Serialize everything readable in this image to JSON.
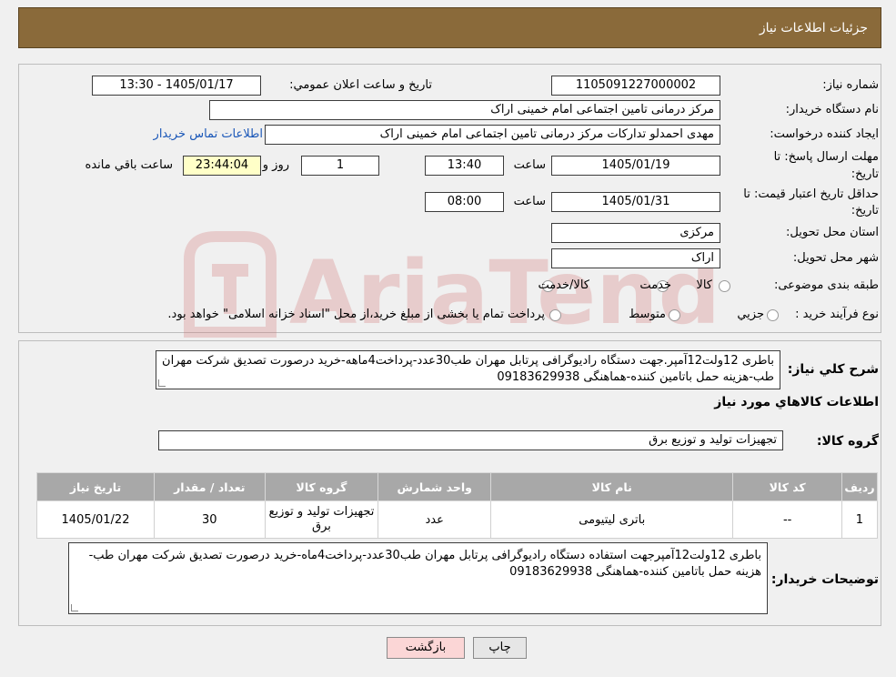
{
  "header": {
    "title": "جزئیات اطلاعات نیاز"
  },
  "form": {
    "need_number_label": "شماره نیاز:",
    "need_number": "1105091227000002",
    "announce_label": "تاریخ و ساعت اعلان عمومي:",
    "announce_value": "1405/01/17 - 13:30",
    "buyer_org_label": "نام دستگاه خریدار:",
    "buyer_org": "مرکز درمانی تامین اجتماعی امام خمینی اراک",
    "requester_label": "ایجاد کننده درخواست:",
    "requester": "مهدی احمدلو تدارکات مرکز درمانی تامین اجتماعی امام خمینی اراک",
    "contact_link": "اطلاعات تماس خریدار",
    "send_deadline_label_1": "مهلت ارسال پاسخ: تا",
    "send_deadline_label_2": "تاریخ:",
    "send_date": "1405/01/19",
    "time_label": "ساعت",
    "send_time": "13:40",
    "days_value": "1",
    "days_label": "روز و",
    "remaining_time": "23:44:04",
    "remaining_label": "ساعت باقي مانده",
    "validity_label_1": "حداقل تاریخ اعتبار قیمت: تا",
    "validity_label_2": "تاریخ:",
    "validity_date": "1405/01/31",
    "validity_time_label": "ساعت",
    "validity_time": "08:00",
    "province_label": "استان محل تحویل:",
    "province": "مرکزی",
    "city_label": "شهر محل تحویل:",
    "city": "اراک",
    "category_label": "طبقه بندی موضوعی:",
    "category_options": [
      "کالا",
      "خدمت",
      "کالا/خدمت"
    ],
    "process_label": "نوع فرآیند خرید :",
    "process_options": [
      "جزیي",
      "متوسط"
    ],
    "process_note": "پرداخت تمام یا بخشی از مبلغ خرید،از محل \"اسناد خزانه اسلامی\" خواهد بود."
  },
  "description": {
    "label": "شرح کلي نیاز:",
    "text": "باطری 12ولت12آمپر.جهت دستگاه رادیوگرافی پرتابل مهران طب30عدد-پرداخت4ماهه-خرید درصورت تصدیق شرکت مهران طب-هزینه حمل باتامین کننده-هماهنگی 09183629938"
  },
  "goods": {
    "section_title": "اطلاعات کالاهاي مورد نیاز",
    "group_label": "گروه کالا:",
    "group_value": "تجهیزات تولید و توزیع برق",
    "columns": [
      "ردیف",
      "کد کالا",
      "نام کالا",
      "واحد شمارش",
      "گروه کالا",
      "تعداد / مقدار",
      "تاریخ نیاز"
    ],
    "rows": [
      {
        "idx": "1",
        "code": "--",
        "name": "باتری لیتیومی",
        "unit": "عدد",
        "group": "تجهیزات تولید و توزیع برق",
        "qty": "30",
        "date": "1405/01/22"
      }
    ]
  },
  "buyer_notes": {
    "label": "توضیحات خریدار:",
    "text": "باطری 12ولت12آمپرجهت استفاده دستگاه رادیوگرافی پرتابل مهران طب30عدد-پرداخت4ماه-خرید درصورت تصدیق شرکت مهران طب-هزینه حمل باتامین کننده-هماهنگی 09183629938"
  },
  "buttons": {
    "print": "چاپ",
    "back": "بازگشت"
  },
  "colors": {
    "header": "#8a6a3a",
    "table_header": "#a8a8a8",
    "back_button": "#fbd6d6"
  }
}
